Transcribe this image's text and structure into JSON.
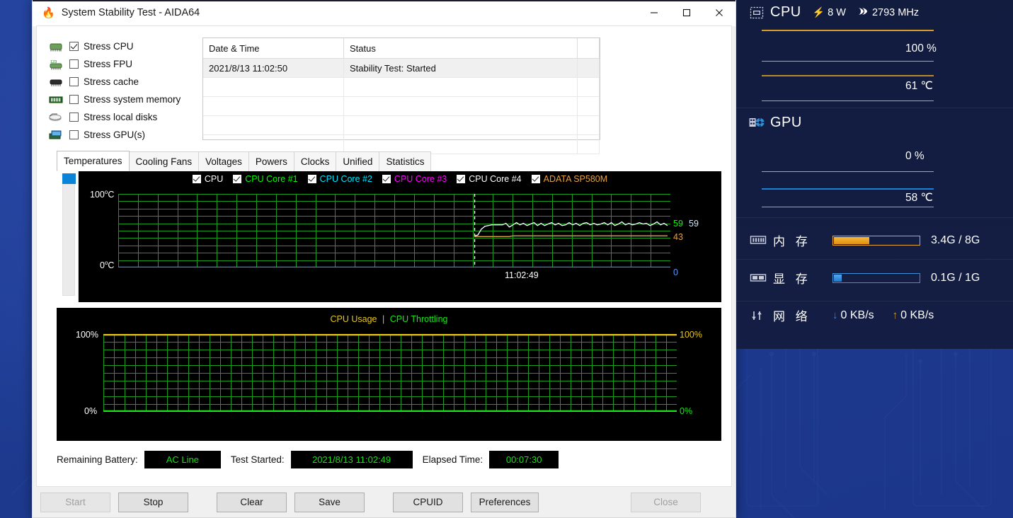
{
  "window": {
    "title": "System Stability Test - AIDA64",
    "app_icon": "flame-icon",
    "minimize_label": "Minimize",
    "maximize_label": "Maximize",
    "close_label": "Close"
  },
  "stress_options": [
    {
      "label": "Stress CPU",
      "checked": true,
      "icon": "cpu-chip-icon"
    },
    {
      "label": "Stress FPU",
      "checked": false,
      "icon": "fpu-chip-icon"
    },
    {
      "label": "Stress cache",
      "checked": false,
      "icon": "cache-chip-icon"
    },
    {
      "label": "Stress system memory",
      "checked": false,
      "icon": "memory-module-icon"
    },
    {
      "label": "Stress local disks",
      "checked": false,
      "icon": "hard-disk-icon"
    },
    {
      "label": "Stress GPU(s)",
      "checked": false,
      "icon": "gpu-card-icon"
    }
  ],
  "log": {
    "columns": [
      "Date & Time",
      "Status",
      ""
    ],
    "rows": [
      {
        "datetime": "2021/8/13 11:02:50",
        "status": "Stability Test: Started"
      },
      {
        "datetime": "",
        "status": ""
      },
      {
        "datetime": "",
        "status": ""
      },
      {
        "datetime": "",
        "status": ""
      },
      {
        "datetime": "",
        "status": ""
      }
    ]
  },
  "tabs": [
    {
      "label": "Temperatures",
      "active": true
    },
    {
      "label": "Cooling Fans",
      "active": false
    },
    {
      "label": "Voltages",
      "active": false
    },
    {
      "label": "Powers",
      "active": false
    },
    {
      "label": "Clocks",
      "active": false
    },
    {
      "label": "Unified",
      "active": false
    },
    {
      "label": "Statistics",
      "active": false
    }
  ],
  "chart_data": [
    {
      "type": "line",
      "title": "Temperatures",
      "ylabel_top": "100",
      "ylabel_top_unit": "°C",
      "ylabel_bottom": "0",
      "ylabel_bottom_unit": "°C",
      "ylim": [
        0,
        100
      ],
      "grid": true,
      "xlabel": "11:02:49",
      "legend_position": "top-center",
      "legend": [
        {
          "label": "CPU",
          "color": "#ffffff",
          "checked": true
        },
        {
          "label": "CPU Core #1",
          "color": "#00ff00",
          "checked": true
        },
        {
          "label": "CPU Core #2",
          "color": "#00e5ff",
          "checked": true
        },
        {
          "label": "CPU Core #3",
          "color": "#ff00ff",
          "checked": true
        },
        {
          "label": "CPU Core #4",
          "color": "#ffffff",
          "checked": true
        },
        {
          "label": "ADATA SP580M",
          "color": "#e8a33d",
          "checked": true
        }
      ],
      "value_labels": [
        {
          "text": "59",
          "color": "#00ff00",
          "value": 59
        },
        {
          "text": "59",
          "color": "#cfe8ff",
          "value": 59
        },
        {
          "text": "43",
          "color": "#e8a33d",
          "value": 43
        },
        {
          "text": "0",
          "color": "#5599ff",
          "value": 0
        }
      ],
      "series": [
        {
          "name": "CPU",
          "color": "#ffffff",
          "values": [
            43,
            44,
            52,
            56,
            57,
            58,
            58,
            58,
            58,
            59,
            57,
            58,
            59,
            59,
            59,
            59,
            59,
            59,
            58,
            59,
            59,
            59,
            59,
            59,
            59,
            59,
            58,
            59,
            59,
            59,
            59,
            60,
            59,
            59,
            59,
            60,
            59,
            59,
            59,
            60,
            59,
            59,
            60,
            59,
            59,
            60,
            59,
            59,
            60,
            59,
            59,
            59,
            60,
            59,
            59,
            59
          ]
        },
        {
          "name": "CPU Core #1",
          "color": "#00ff00",
          "values": [
            43,
            44,
            52,
            56,
            57,
            58,
            58,
            58,
            58,
            59,
            57,
            58,
            59,
            59,
            59,
            59,
            59,
            59,
            58,
            59,
            59,
            59,
            59,
            59,
            59,
            59,
            58,
            59,
            59,
            59,
            59,
            60,
            59,
            59,
            59,
            60,
            59,
            59,
            59,
            60,
            59,
            59,
            60,
            59,
            59,
            60,
            59,
            59,
            60,
            59,
            59,
            59,
            60,
            59,
            59,
            59
          ]
        },
        {
          "name": "CPU Core #2",
          "color": "#00e5ff",
          "values": [
            43,
            44,
            52,
            56,
            57,
            58,
            58,
            58,
            58,
            59,
            57,
            58,
            59,
            59,
            59,
            59,
            59,
            59,
            58,
            59,
            59,
            59,
            59,
            59,
            59,
            59,
            58,
            59,
            59,
            59,
            59,
            60,
            59,
            59,
            59,
            60,
            59,
            59,
            59,
            60,
            59,
            59,
            60,
            59,
            59,
            60,
            59,
            59,
            60,
            59,
            59,
            59,
            60,
            59,
            59,
            59
          ]
        },
        {
          "name": "CPU Core #3",
          "color": "#ff00ff",
          "values": [
            43,
            44,
            52,
            56,
            57,
            58,
            58,
            58,
            58,
            59,
            57,
            58,
            59,
            59,
            59,
            59,
            59,
            59,
            58,
            59,
            59,
            59,
            59,
            59,
            59,
            59,
            58,
            59,
            59,
            59,
            59,
            60,
            59,
            59,
            59,
            60,
            59,
            59,
            59,
            60,
            59,
            59,
            60,
            59,
            59,
            60,
            59,
            59,
            60,
            59,
            59,
            59,
            60,
            59,
            59,
            59
          ]
        },
        {
          "name": "ADATA SP580M",
          "color": "#e8a33d",
          "values": [
            42,
            42,
            42,
            42,
            42,
            42,
            42,
            42,
            42,
            42,
            42,
            43,
            43,
            43,
            43,
            43,
            43,
            43,
            43,
            43,
            43,
            43,
            43,
            43,
            43,
            43,
            43,
            43,
            43,
            43,
            43,
            43,
            43,
            43,
            43,
            43,
            43,
            43,
            43,
            43,
            43,
            43,
            43,
            43,
            43,
            43,
            43,
            43,
            43,
            43,
            43,
            43,
            43,
            43,
            43,
            43
          ]
        }
      ]
    },
    {
      "type": "line",
      "title_parts": [
        {
          "text": "CPU Usage",
          "color": "#e6c619"
        },
        {
          "text": "|",
          "color": "#bbbbbb"
        },
        {
          "text": "CPU Throttling",
          "color": "#19e619"
        }
      ],
      "ylabel_top": "100%",
      "ylabel_bottom": "0%",
      "ylabel_top_right": "100%",
      "ylabel_bottom_right": "0%",
      "ylim": [
        0,
        100
      ],
      "grid": true,
      "series": [
        {
          "name": "CPU Usage",
          "color": "#e6c619",
          "constant": 100
        },
        {
          "name": "CPU Throttling",
          "color": "#19e619",
          "constant": 0
        }
      ]
    }
  ],
  "status": {
    "battery_label": "Remaining Battery:",
    "battery_value": "AC Line",
    "started_label": "Test Started:",
    "started_value": "2021/8/13 11:02:49",
    "elapsed_label": "Elapsed Time:",
    "elapsed_value": "00:07:30"
  },
  "footer_buttons": [
    {
      "label": "Start",
      "disabled": true
    },
    {
      "label": "Stop",
      "disabled": false
    },
    {
      "label": "Clear",
      "disabled": false
    },
    {
      "label": "Save",
      "disabled": false
    },
    {
      "label": "CPUID",
      "disabled": false
    },
    {
      "label": "Preferences",
      "disabled": false
    },
    {
      "label": "Close",
      "disabled": true
    }
  ],
  "sidebar": {
    "cpu": {
      "name": "CPU",
      "power_icon": "lightning-bolt-icon",
      "power": "8 W",
      "clock_icon": "waves-icon",
      "clock": "2793 MHz",
      "usage_value": "100 %",
      "temp_value": "61 ℃",
      "usage_color": "#d99a2b",
      "temp_color": "#b98a2c"
    },
    "gpu": {
      "name": "GPU",
      "usage_value": "0 %",
      "temp_value": "58 ℃",
      "usage_color": "#9aa5bf",
      "temp_color": "#1e7fd6"
    },
    "memory": {
      "icon": "ram-stick-icon",
      "label": "内 存",
      "value": "3.4G / 8G",
      "percent": 43,
      "bar_color": "#f0a81e",
      "border_color": "#e8a33d"
    },
    "vram": {
      "icon": "vram-icon",
      "label": "显 存",
      "value": "0.1G / 1G",
      "percent": 11,
      "bar_color": "#2f8fe8",
      "border_color": "#3d8fd6"
    },
    "network": {
      "icon": "network-arrows-icon",
      "label": "网 络",
      "down_icon": "arrow-down-icon",
      "down": "0 KB/s",
      "up_icon": "arrow-up-icon",
      "up": "0 KB/s",
      "down_color": "#3d7fd6",
      "up_color": "#d99a2b"
    }
  }
}
